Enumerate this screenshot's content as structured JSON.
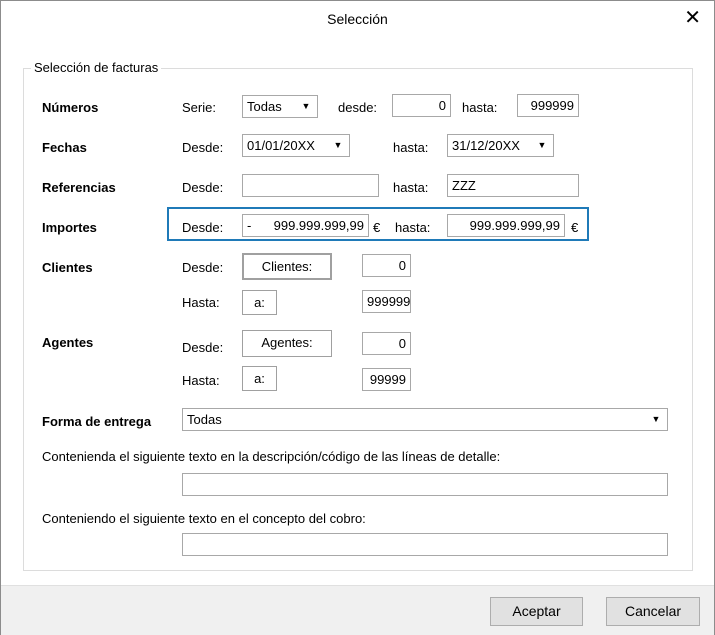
{
  "dialog": {
    "title": "Selección",
    "close_glyph": "✕"
  },
  "group": {
    "legend": "Selección de facturas"
  },
  "numeros": {
    "label": "Números",
    "serie_label": "Serie:",
    "serie_value": "Todas",
    "desde_label": "desde:",
    "desde_value": "0",
    "hasta_label": "hasta:",
    "hasta_value": "999999"
  },
  "fechas": {
    "label": "Fechas",
    "desde_label": "Desde:",
    "desde_value": "01/01/20XX",
    "hasta_label": "hasta:",
    "hasta_value": "31/12/20XX"
  },
  "referencias": {
    "label": "Referencias",
    "desde_label": "Desde:",
    "desde_value": "",
    "hasta_label": "hasta:",
    "hasta_value": "ZZZ"
  },
  "importes": {
    "label": "Importes",
    "desde_label": "Desde:",
    "desde_sign": "-",
    "desde_value": "999.999.999,99",
    "desde_currency": "€",
    "hasta_label": "hasta:",
    "hasta_value": "999.999.999,99",
    "hasta_currency": "€"
  },
  "clientes": {
    "label": "Clientes",
    "desde_label": "Desde:",
    "desde_button": "Clientes:",
    "desde_value": "0",
    "hasta_label": "Hasta:",
    "hasta_button": "a:",
    "hasta_value": "999999"
  },
  "agentes": {
    "label": "Agentes",
    "desde_label": "Desde:",
    "desde_button": "Agentes:",
    "desde_value": "0",
    "hasta_label": "Hasta:",
    "hasta_button": "a:",
    "hasta_value": "99999"
  },
  "forma_entrega": {
    "label": "Forma de entrega",
    "value": "Todas"
  },
  "texto_detalle": {
    "label": "Contenienda el siguiente texto en la descripción/código de las líneas de detalle:",
    "value": ""
  },
  "texto_cobro": {
    "label": "Conteniendo el siguiente texto en el concepto del cobro:",
    "value": ""
  },
  "footer": {
    "accept_label": "Aceptar",
    "cancel_label": "Cancelar"
  },
  "icons": {
    "dropdown": "▼"
  }
}
